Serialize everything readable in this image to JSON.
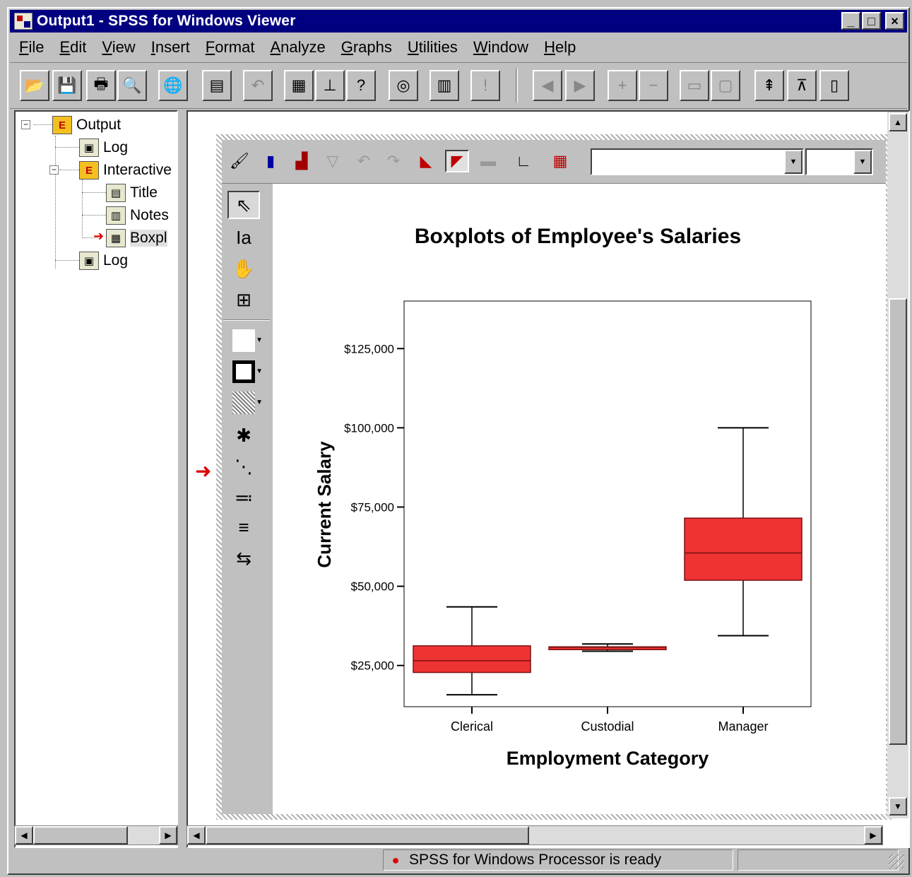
{
  "window": {
    "title": "Output1 - SPSS for Windows Viewer",
    "minimize": "_",
    "maximize": "□",
    "close": "×"
  },
  "menu": [
    "File",
    "Edit",
    "View",
    "Insert",
    "Format",
    "Analyze",
    "Graphs",
    "Utilities",
    "Window",
    "Help"
  ],
  "tree": {
    "items": [
      {
        "label": "Output"
      },
      {
        "label": "Log"
      },
      {
        "label": "Interactive"
      },
      {
        "label": "Title"
      },
      {
        "label": "Notes"
      },
      {
        "label": "Boxpl"
      },
      {
        "label": "Log"
      }
    ]
  },
  "status": {
    "message": "SPSS for Windows Processor is ready"
  },
  "colors": {
    "titlebar": "#000080",
    "box_fill": "#ee3333",
    "box_stroke": "#7a1010",
    "marker": "#e00000"
  },
  "chart_data": {
    "type": "boxplot",
    "title": "Boxplots of Employee's Salaries",
    "xlabel": "Employment Category",
    "ylabel": "Current Salary",
    "categories": [
      "Clerical",
      "Custodial",
      "Manager"
    ],
    "ylim": [
      12000,
      140000
    ],
    "y_ticks": [
      25000,
      50000,
      75000,
      100000,
      125000
    ],
    "y_tick_labels": [
      "$25,000",
      "$50,000",
      "$75,000",
      "$100,000",
      "$125,000"
    ],
    "boxes": [
      {
        "category": "Clerical",
        "min": 15750,
        "q1": 22800,
        "median": 26500,
        "q3": 31200,
        "max": 43500
      },
      {
        "category": "Custodial",
        "min": 29500,
        "q1": 30000,
        "median": 30750,
        "q3": 30900,
        "max": 31800
      },
      {
        "category": "Manager",
        "min": 34400,
        "q1": 51900,
        "median": 60500,
        "q3": 71500,
        "max": 100000
      }
    ]
  }
}
